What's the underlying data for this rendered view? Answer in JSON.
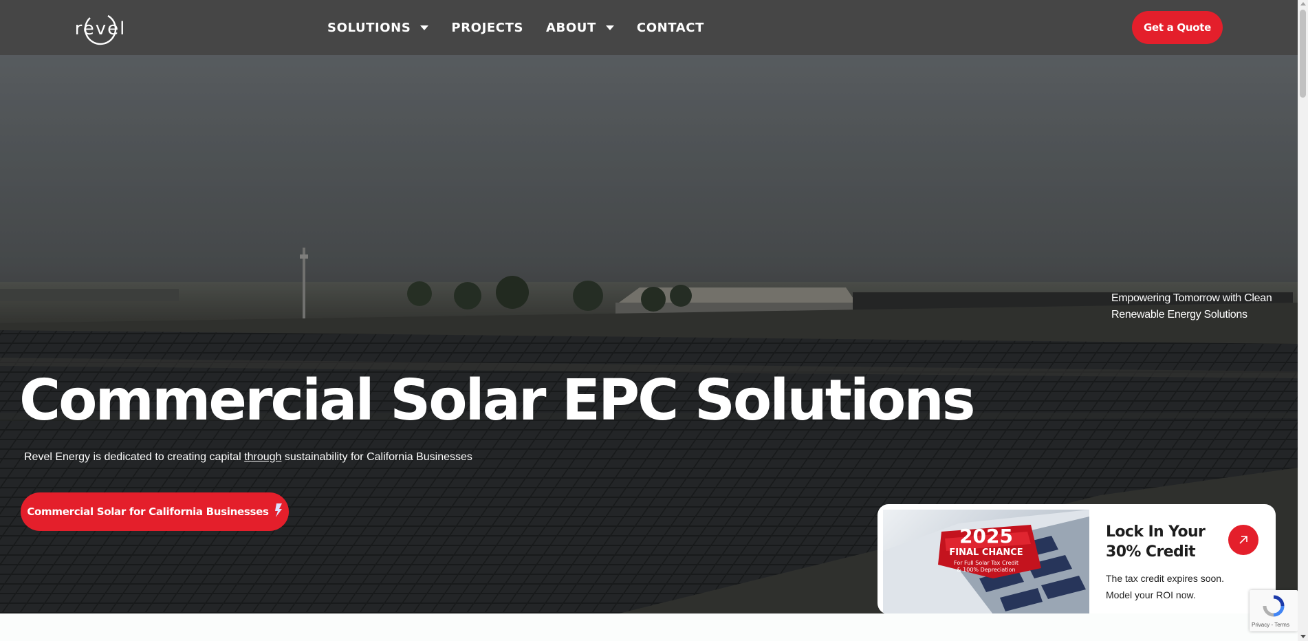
{
  "header": {
    "logo_text": "revel",
    "nav": [
      {
        "label": "SOLUTIONS",
        "has_dropdown": true
      },
      {
        "label": "PROJECTS",
        "has_dropdown": false
      },
      {
        "label": "ABOUT",
        "has_dropdown": true
      },
      {
        "label": "CONTACT",
        "has_dropdown": false
      }
    ],
    "quote_label": "Get a Quote"
  },
  "hero": {
    "tagline": "Empowering Tomorrow with Clean Renewable Energy Solutions",
    "title": "Commercial Solar EPC Solutions",
    "subtitle_pre": "Revel Energy is dedicated to creating capital ",
    "subtitle_link": "through",
    "subtitle_post": " sustainability for California Businesses",
    "cta_label": "Commercial Solar for California Businesses",
    "cta_icon": "bolt-icon"
  },
  "promo": {
    "badge_year": "2025",
    "badge_title": "FINAL CHANCE",
    "badge_line1": "For Full Solar Tax Credit",
    "badge_line2": "& 100% Depreciation",
    "title": "Lock In Your 30% Credit",
    "description": "The tax credit expires soon. Model your ROI now.",
    "arrow_icon": "arrow-up-right-icon"
  },
  "recaptcha": {
    "text": "Privacy - Terms"
  },
  "colors": {
    "header_bg": "#464646",
    "accent": "#e41f2b",
    "text_light": "#ffffff"
  }
}
